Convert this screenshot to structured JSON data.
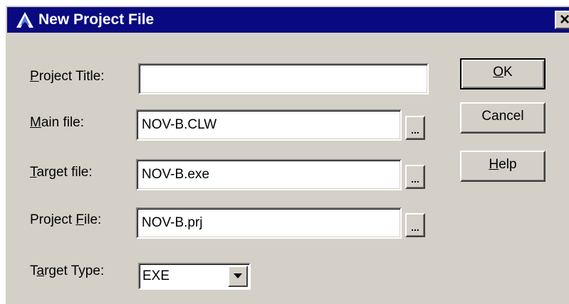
{
  "window": {
    "title": "New Project File",
    "close_symbol": "×",
    "title_icon": "clarion-app-icon"
  },
  "fields": {
    "project_title": {
      "label_pre": "",
      "label_key": "P",
      "label_post": "roject Title:",
      "value": ""
    },
    "main_file": {
      "label_pre": "",
      "label_key": "M",
      "label_post": "ain file:",
      "value": "NOV-B.CLW"
    },
    "target_file": {
      "label_pre": "",
      "label_key": "T",
      "label_post": "arget file:",
      "value": "NOV-B.exe"
    },
    "project_file": {
      "label_pre": "Project ",
      "label_key": "F",
      "label_post": "ile:",
      "value": "NOV-B.prj"
    },
    "target_type": {
      "label_pre": "T",
      "label_key": "a",
      "label_post": "rget Type:",
      "value": "EXE"
    }
  },
  "browse_label": "...",
  "buttons": {
    "ok": {
      "key": "O",
      "rest": "K"
    },
    "cancel": {
      "label": "Cancel"
    },
    "help": {
      "key": "H",
      "rest": "elp"
    }
  },
  "colors": {
    "titlebar": "#0a0a80",
    "face": "#d4d0c8"
  }
}
